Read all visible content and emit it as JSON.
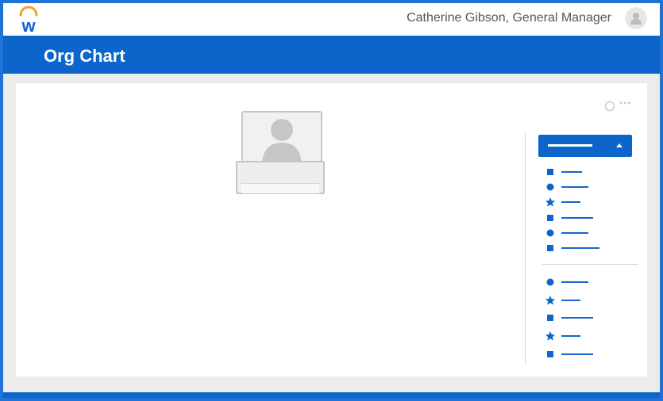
{
  "header": {
    "user_label": "Catherine Gibson, General Manager"
  },
  "page": {
    "title": "Org Chart"
  },
  "colors": {
    "brand_blue": "#0c65cb",
    "logo_arc": "#f3a02d"
  },
  "icons": {
    "logo": "workday-logo",
    "avatar": "user-avatar-icon",
    "settings": "gear-icon",
    "more": "more-icon",
    "legend_toggle": "chevron-up-icon"
  },
  "legend": {
    "group1": [
      "square",
      "circle",
      "star",
      "square",
      "circle",
      "square"
    ],
    "group2": [
      "circle",
      "star",
      "square",
      "star",
      "square"
    ]
  }
}
